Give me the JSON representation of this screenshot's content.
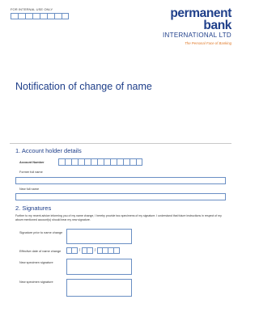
{
  "header": {
    "internal_use_label": "FOR INTERNAL USE ONLY",
    "logo_name": "permanent bank",
    "logo_sub": "INTERNATIONAL LTD",
    "logo_tagline": "The Personal Face of Banking"
  },
  "title": "Notification of change of name",
  "section1": {
    "heading": "1. Account holder details",
    "account_number_label": "Account Number",
    "former_name_label": "Former full name",
    "new_name_label": "New full name"
  },
  "section2": {
    "heading": "2. Signatures",
    "instructions": "Further to my recent advice informing you of my name change, I hereby provide two specimens of my signature. I understand that future instructions in respect of my above mentioned account(s) should bear my new signature.",
    "sig_prior_label": "Signature prior to name change",
    "effective_date_label": "Effective date of name change",
    "date_separator": "/",
    "new_sig_label_1": "New specimen signature",
    "new_sig_label_2": "New specimen signature"
  },
  "colors": {
    "brand_blue": "#1f3f8a",
    "accent_orange": "#e07a2a",
    "box_border": "#6a8fc4"
  }
}
